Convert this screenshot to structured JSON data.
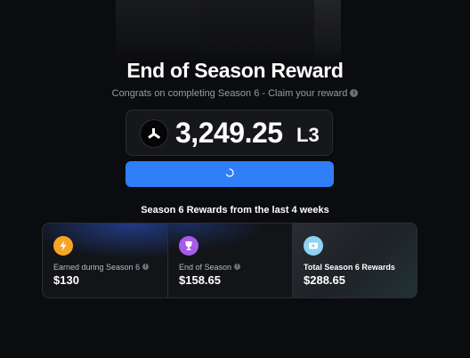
{
  "header": {
    "title": "End of Season Reward",
    "subtitle": "Congrats on completing Season 6 - Claim your reward"
  },
  "reward": {
    "amount": "3,249.25",
    "unit": "L3",
    "token_icon": "l3-token-icon"
  },
  "claim_button": {
    "state": "loading",
    "icon": "spinner-icon"
  },
  "rewards_section": {
    "heading": "Season 6 Rewards from the last 4 weeks",
    "cards": [
      {
        "label": "Earned during Season 6",
        "value": "$130",
        "icon": "lightning-icon",
        "color": "#f5a524"
      },
      {
        "label": "End of Season",
        "value": "$158.65",
        "icon": "trophy-icon",
        "color": "#a65ce8"
      },
      {
        "label": "Total Season 6 Rewards",
        "value": "$288.65",
        "icon": "ticket-icon",
        "color": "#8fd3f0"
      }
    ]
  },
  "colors": {
    "background": "#0b0c0f",
    "accent": "#2f7ef7"
  }
}
